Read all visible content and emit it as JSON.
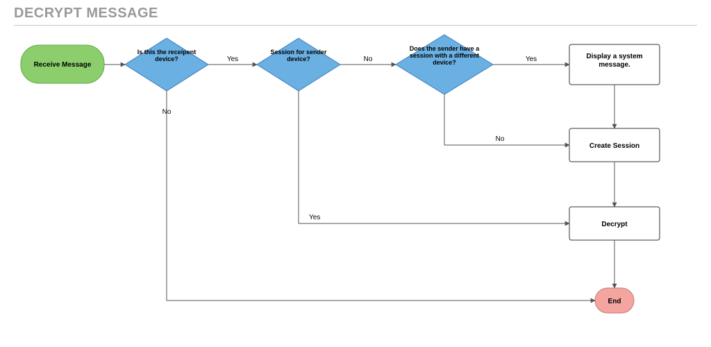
{
  "title": "DECRYPT MESSAGE",
  "nodes": {
    "receive": "Receive Message",
    "q1": "Is this the receipent device?",
    "q2": "Session for sender device?",
    "q3": "Does the sender have a session with a different device?",
    "display": "Display a system message.",
    "createSession": "Create Session",
    "decrypt": "Decrypt",
    "end": "End"
  },
  "labels": {
    "yes": "Yes",
    "no": "No"
  }
}
